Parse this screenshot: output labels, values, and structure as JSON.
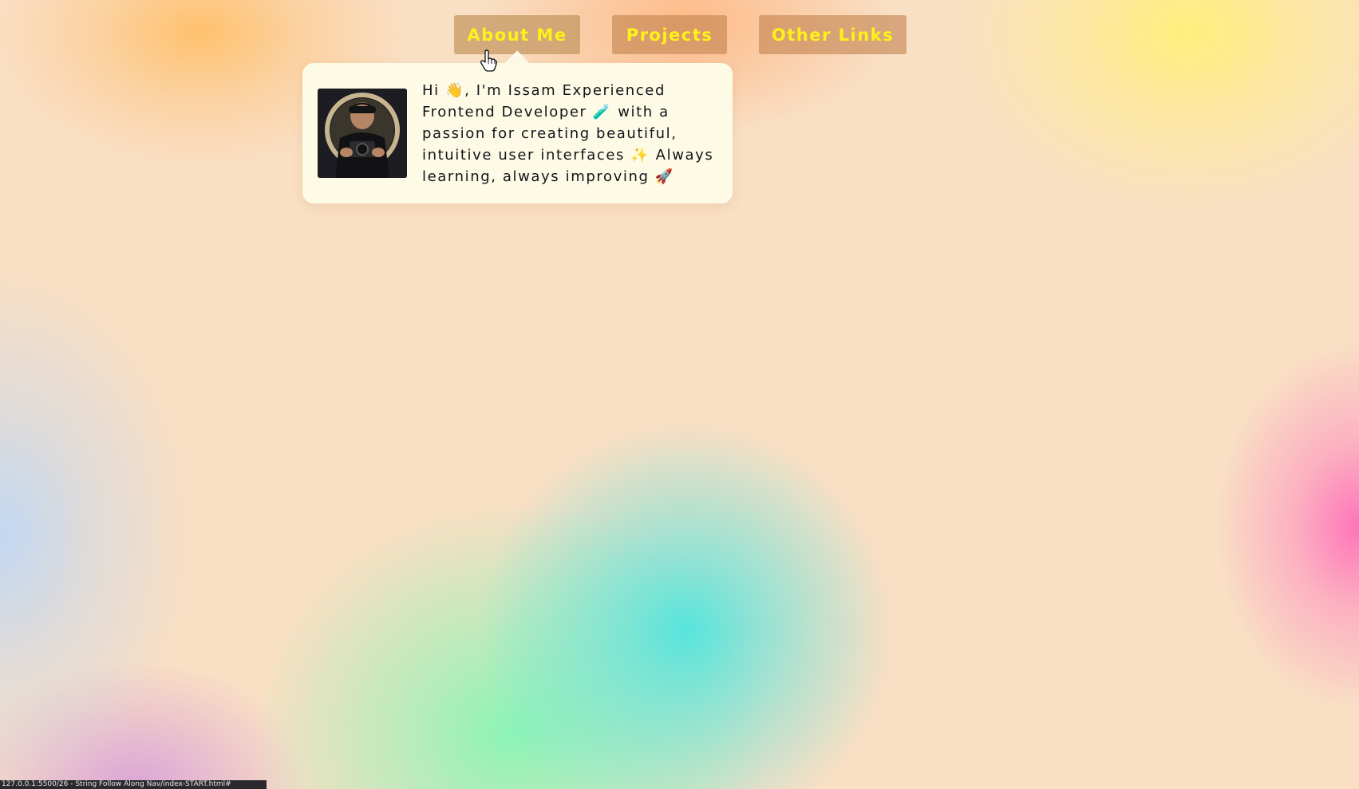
{
  "nav": {
    "about_label": "About Me",
    "projects_label": "Projects",
    "links_label": "Other Links"
  },
  "about_card": {
    "bio": "Hi 👋, I'm Issam Experienced Frontend Developer 🧪 with a passion for creating beautiful, intuitive user interfaces ✨ Always learning, always improving 🚀",
    "avatar_alt": "avatar"
  },
  "statusbar": {
    "url": "127.0.0.1:5500/26 - String Follow Along Nav/index-START.html#"
  },
  "colors": {
    "nav_text": "#fff11a",
    "nav_bg": "#c48450",
    "card_bg": "#fdfbe6",
    "text": "#15131a"
  },
  "icons": {
    "cursor": "hand-pointer-icon"
  }
}
